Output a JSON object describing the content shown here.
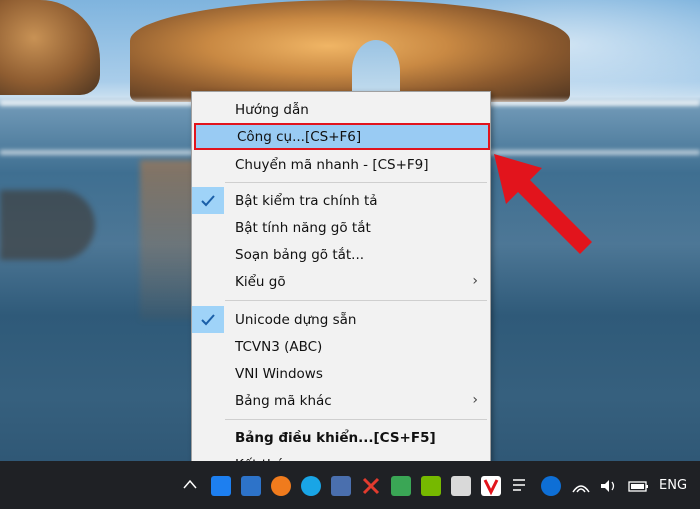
{
  "menu": {
    "items": [
      {
        "label": "Hướng dẫn"
      },
      {
        "label": "Công cụ...[CS+F6]"
      },
      {
        "label": "Chuyển mã nhanh - [CS+F9]"
      },
      {
        "label": "Bật kiểm tra chính tả"
      },
      {
        "label": "Bật tính năng gõ tắt"
      },
      {
        "label": "Soạn bảng gõ tắt..."
      },
      {
        "label": "Kiểu gõ"
      },
      {
        "label": "Unicode dựng sẵn"
      },
      {
        "label": "TCVN3 (ABC)"
      },
      {
        "label": "VNI Windows"
      },
      {
        "label": "Bảng mã khác"
      },
      {
        "label": "Bảng điều khiển...[CS+F5]"
      },
      {
        "label": "Kết thúc"
      }
    ]
  },
  "taskbar": {
    "language": "ENG",
    "tray_icons": [
      "chevron-up-icon",
      "zalo-icon",
      "app-icon",
      "fox-icon",
      "skype-icon",
      "app2-icon",
      "x-icon",
      "check-icon",
      "nvidia-icon",
      "device-icon",
      "unikey-icon",
      "notification-icon",
      "teamviewer-icon",
      "wifi-icon",
      "volume-icon",
      "battery-icon"
    ]
  },
  "colors": {
    "highlight": "#99cbf3",
    "highlight_border": "#e2141c",
    "arrow": "#e2141c",
    "check_bg": "#9fd3f8"
  }
}
